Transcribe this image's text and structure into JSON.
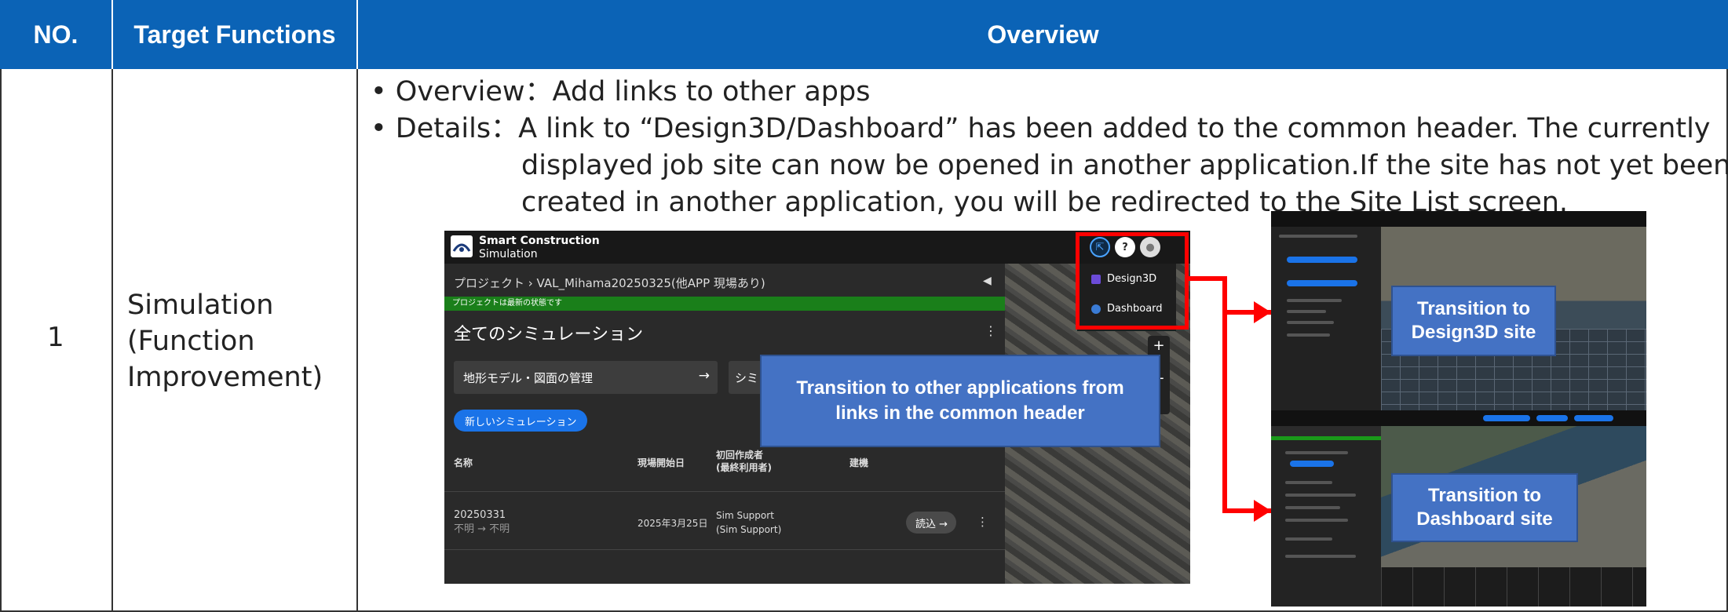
{
  "table": {
    "headers": {
      "no": "NO.",
      "target": "Target Functions",
      "overview": "Overview"
    },
    "row": {
      "no": "1",
      "target_lines": [
        "Simulation",
        "(Function",
        "Improvement)"
      ],
      "overview_bullet": "• Overview：Add links to other apps",
      "details_first": "• Details：A link to “Design3D/Dashboard” has been added to the common header. The currently",
      "details_second": "displayed job site can now be opened in another application.If the site has not yet been",
      "details_third": "created in another application, you will be redirected to the Site List screen."
    }
  },
  "sim_screen": {
    "brand_line1": "Smart Construction",
    "brand_line2": "Simulation",
    "breadcrumb": "プロジェクト › VAL_Mihama20250325(他APP 現場あり)",
    "status_bar": "プロジェクトは最新の状態です",
    "heading": "全てのシミュレーション",
    "terrain_button": "地形モデル・図面の管理",
    "sim_button": "シミュ",
    "new_button": "新しいシミュレーション",
    "columns": [
      "名称",
      "現場開始日",
      "初回作成者",
      "(最終利用者)",
      "建機"
    ],
    "row_name": "20250331",
    "row_sub": "不明 → 不明",
    "row_date": "2025年3月25日",
    "row_creator": "Sim Support",
    "row_creator_sub": "(Sim Support)",
    "read_button": "読込 →",
    "menu": [
      "Design3D",
      "Dashboard"
    ]
  },
  "callouts": {
    "center_line1": "Transition to other applications from",
    "center_line2": "links in the common header",
    "design3d_line1": "Transition to",
    "design3d_line2": "Design3D site",
    "dashboard_line1": "Transition to",
    "dashboard_line2": "Dashboard site"
  },
  "colors": {
    "header_blue": "#0b63b6",
    "callout_blue": "#4472c4",
    "highlight_red": "#ff0000"
  }
}
